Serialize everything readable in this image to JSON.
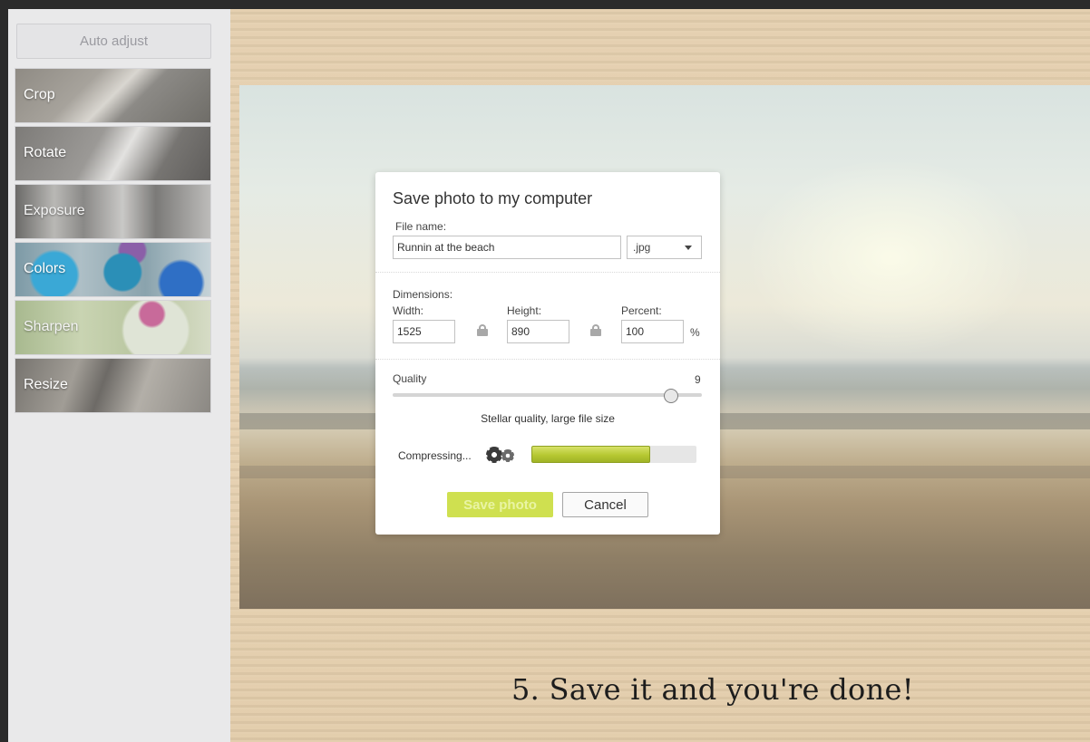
{
  "sidebar": {
    "auto_adjust_label": "Auto adjust",
    "tools": [
      {
        "label": "Crop"
      },
      {
        "label": "Rotate"
      },
      {
        "label": "Exposure"
      },
      {
        "label": "Colors"
      },
      {
        "label": "Sharpen"
      },
      {
        "label": "Resize"
      }
    ]
  },
  "caption": "5. Save it and you're done!",
  "dialog": {
    "title": "Save photo to my computer",
    "file_name_label": "File name:",
    "file_name_value": "Runnin at the beach",
    "format_selected": ".jpg",
    "dimensions_label": "Dimensions:",
    "width_label": "Width:",
    "width_value": "1525",
    "height_label": "Height:",
    "height_value": "890",
    "percent_label": "Percent:",
    "percent_value": "100",
    "percent_unit": "%",
    "quality_label": "Quality",
    "quality_value": "9",
    "quality_max": 10,
    "quality_description": "Stellar quality, large file size",
    "compressing_label": "Compressing...",
    "progress_fraction": 0.72,
    "save_label": "Save photo",
    "cancel_label": "Cancel"
  },
  "colors": {
    "save_button": "#cfe050",
    "progress_fill": "#b6c832"
  },
  "icons": {
    "format_dropdown": "chevron-down-icon",
    "lock": "lock-icon",
    "compressing": "gears-icon"
  }
}
